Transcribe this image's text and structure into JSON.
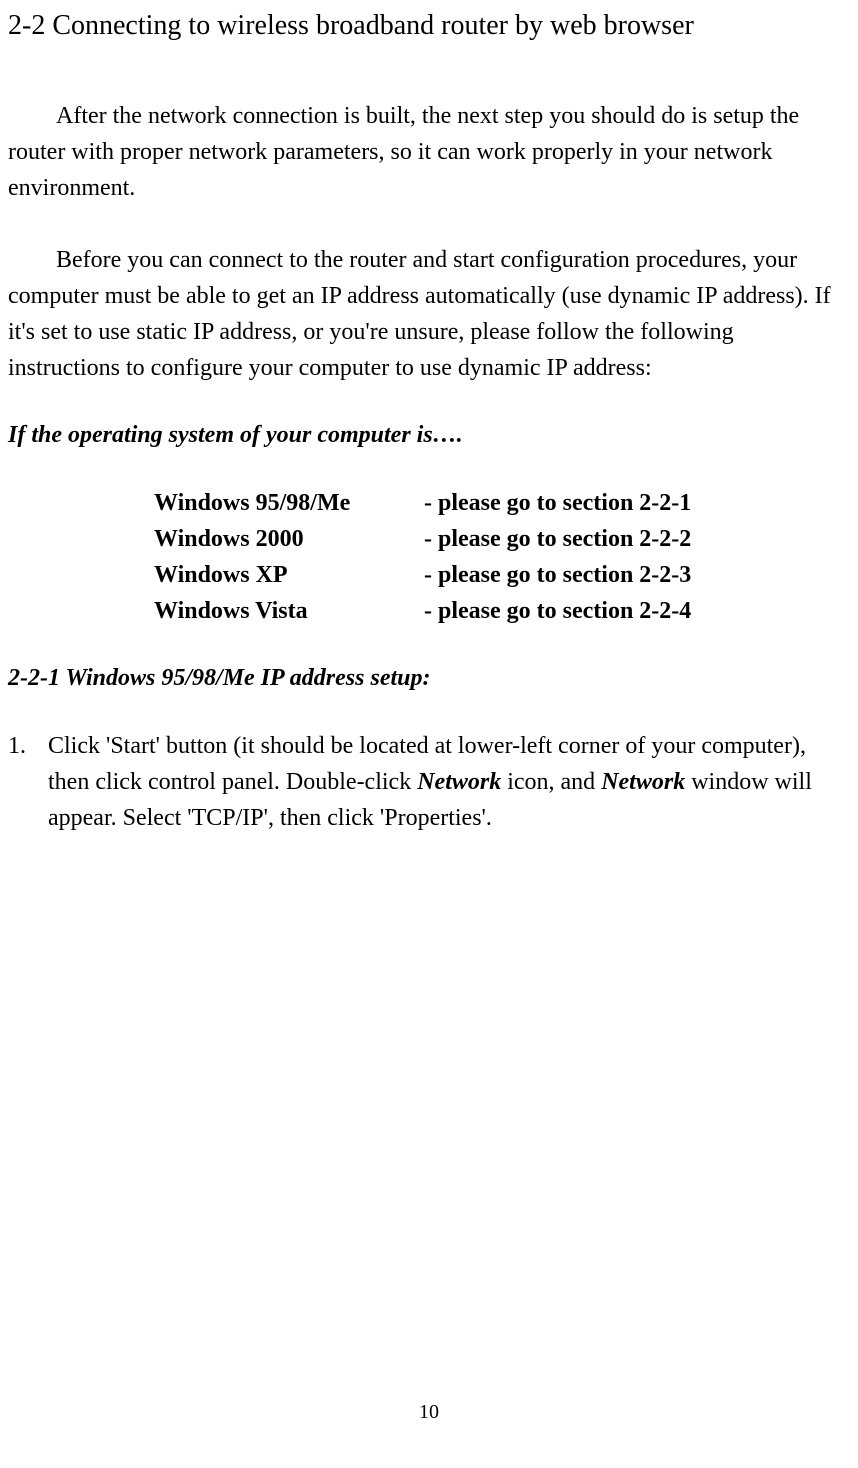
{
  "section_title": "2-2 Connecting to wireless broadband router by web browser",
  "paragraph1": "After the network connection is built, the next step you should do is setup the router with proper network parameters, so it can work properly in your network environment.",
  "paragraph2": "Before you can connect to the router and start configuration procedures, your computer must be able to get an IP address automatically (use dynamic IP address). If it's set to use static IP address, or you're unsure, please follow the following instructions to configure your computer to use dynamic IP address:",
  "os_heading": "If the operating system of your computer is….",
  "os_table": [
    {
      "os": "Windows 95/98/Me",
      "ref": "- please go to section 2-2-1"
    },
    {
      "os": "Windows 2000",
      "ref": "- please go to section 2-2-2"
    },
    {
      "os": "Windows XP",
      "ref": "- please go to section 2-2-3"
    },
    {
      "os": "Windows Vista",
      "ref": "- please go to section 2-2-4"
    }
  ],
  "subsection_title": "2-2-1 Windows 95/98/Me IP address setup:",
  "step_number": "1.",
  "step_text_1": "Click 'Start' button (it should be located at lower-left corner of your computer), then click control panel. Double-click ",
  "step_text_network1": "Network",
  "step_text_2": " icon, and ",
  "step_text_network2": "Network",
  "step_text_3": " window will appear. Select 'TCP/IP', then click 'Properties'.",
  "page_number": "10"
}
